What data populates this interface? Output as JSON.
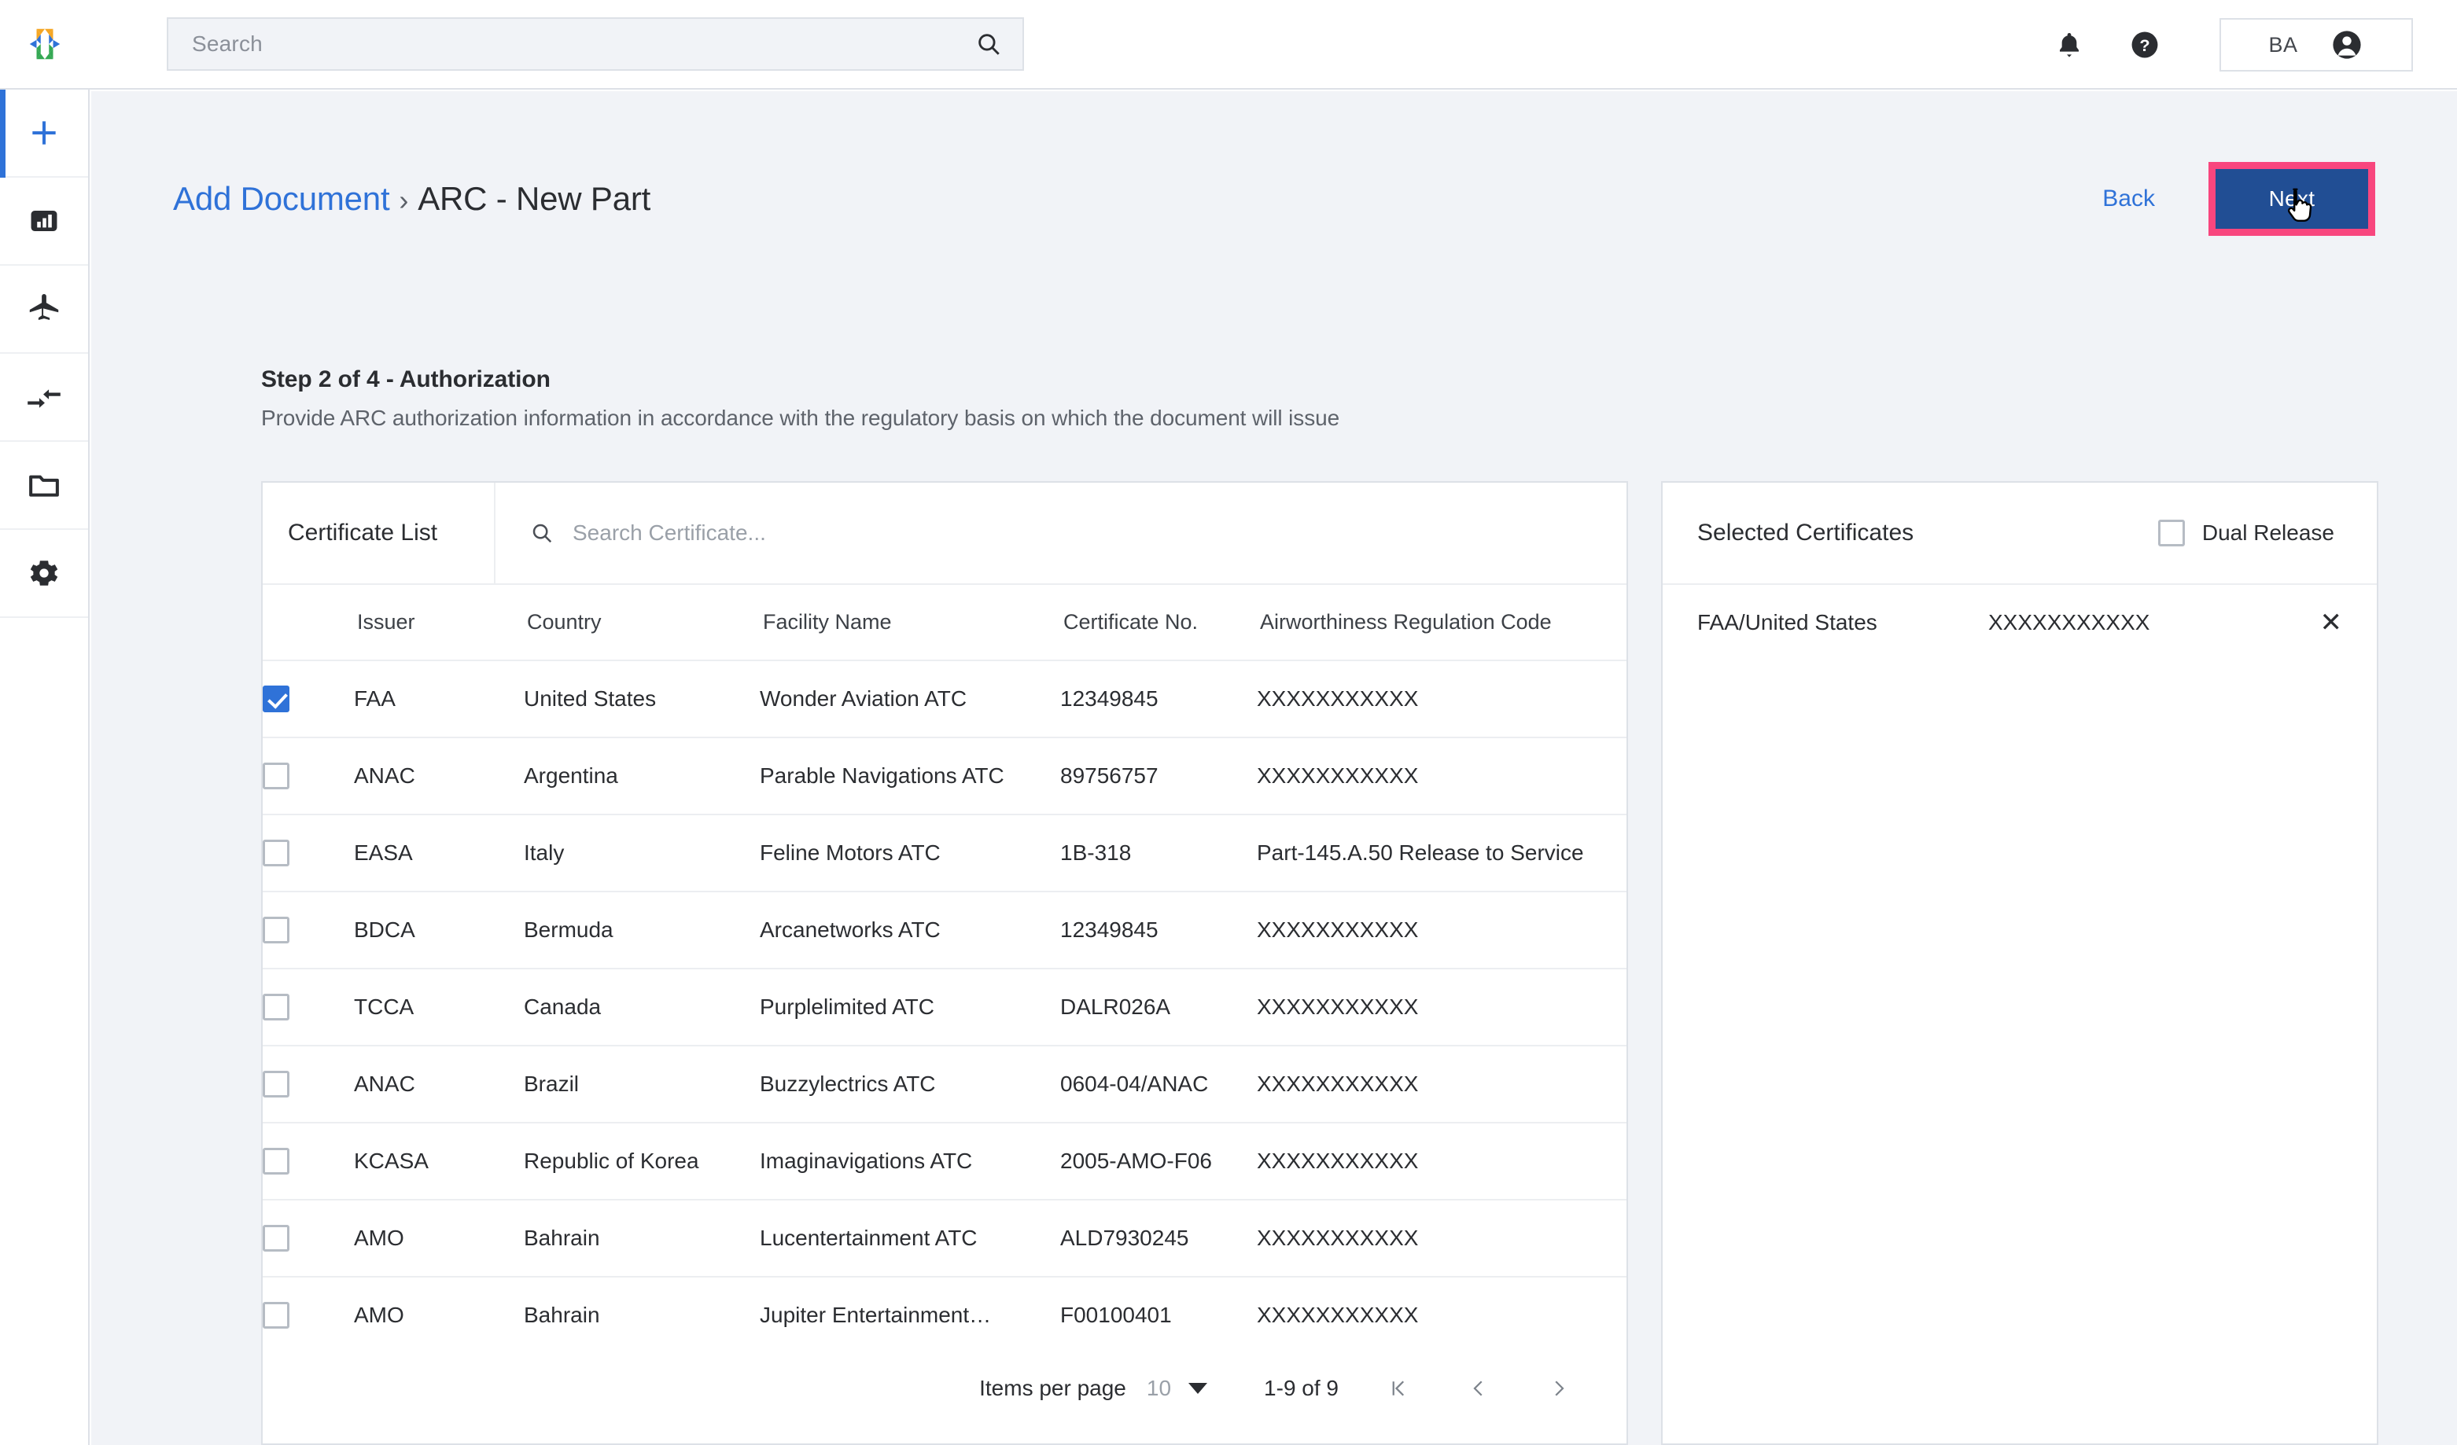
{
  "brand": {
    "logo_icon": "hexagon-logo-icon",
    "accent_blue": "#2f72d8",
    "button_blue": "#214e94",
    "highlight_pink": "#f8467e"
  },
  "topbar": {
    "search": {
      "placeholder": "Search",
      "value": "",
      "icon": "search-icon"
    },
    "notifications_icon": "bell-icon",
    "help_icon": "help-circle-icon",
    "user_initials": "BA",
    "user_avatar_icon": "account-circle-icon"
  },
  "sidebar": {
    "items": [
      {
        "name": "add",
        "icon": "plus-icon",
        "active": true
      },
      {
        "name": "dashboard",
        "icon": "bar-chart-icon",
        "active": false
      },
      {
        "name": "aircraft",
        "icon": "airplane-icon",
        "active": false
      },
      {
        "name": "transfer",
        "icon": "transfer-arrows-icon",
        "active": false
      },
      {
        "name": "documents",
        "icon": "folder-icon",
        "active": false
      },
      {
        "name": "settings",
        "icon": "gear-icon",
        "active": false
      }
    ]
  },
  "page": {
    "breadcrumb_link": "Add Document",
    "breadcrumb_separator": "›",
    "breadcrumb_current": "ARC - New Part",
    "back_label": "Back",
    "next_label": "Next",
    "step_title": "Step 2 of 4 - Authorization",
    "step_description": "Provide ARC authorization information in accordance with the regulatory basis on which the document will issue"
  },
  "certificate_list": {
    "title": "Certificate List",
    "search_placeholder": "Search Certificate...",
    "search_icon": "search-icon",
    "columns": [
      "Issuer",
      "Country",
      "Facility Name",
      "Certificate No.",
      "Airworthiness Regulation Code"
    ],
    "rows": [
      {
        "checked": true,
        "issuer": "FAA",
        "country": "United States",
        "facility": "Wonder Aviation ATC",
        "certificate_no": "12349845",
        "regulation_code": "XXXXXXXXXXX"
      },
      {
        "checked": false,
        "issuer": "ANAC",
        "country": "Argentina",
        "facility": "Parable Navigations ATC",
        "certificate_no": "89756757",
        "regulation_code": "XXXXXXXXXXX"
      },
      {
        "checked": false,
        "issuer": "EASA",
        "country": "Italy",
        "facility": "Feline Motors ATC",
        "certificate_no": "1B-318",
        "regulation_code": "Part-145.A.50 Release to Service"
      },
      {
        "checked": false,
        "issuer": "BDCA",
        "country": "Bermuda",
        "facility": "Arcanetworks ATC",
        "certificate_no": "12349845",
        "regulation_code": "XXXXXXXXXXX"
      },
      {
        "checked": false,
        "issuer": "TCCA",
        "country": "Canada",
        "facility": "Purplelimited ATC",
        "certificate_no": "DALR026A",
        "regulation_code": "XXXXXXXXXXX"
      },
      {
        "checked": false,
        "issuer": "ANAC",
        "country": "Brazil",
        "facility": "Buzzylectrics ATC",
        "certificate_no": "0604-04/ANAC",
        "regulation_code": "XXXXXXXXXXX"
      },
      {
        "checked": false,
        "issuer": "KCASA",
        "country": "Republic of Korea",
        "facility": "Imaginavigations ATC",
        "certificate_no": "2005-AMO-F06",
        "regulation_code": "XXXXXXXXXXX"
      },
      {
        "checked": false,
        "issuer": "AMO",
        "country": "Bahrain",
        "facility": "Lucentertainment ATC",
        "certificate_no": "ALD7930245",
        "regulation_code": "XXXXXXXXXXX"
      },
      {
        "checked": false,
        "issuer": "AMO",
        "country": "Bahrain",
        "facility": "Jupiter Entertainment…",
        "certificate_no": "F00100401",
        "regulation_code": "XXXXXXXXXXX"
      }
    ],
    "pagination": {
      "items_per_page_label": "Items per page",
      "items_per_page_value": "10",
      "range_label": "1-9 of 9",
      "first_page_icon": "first-page-icon",
      "prev_page_icon": "chevron-left-icon",
      "next_page_icon": "chevron-right-icon"
    }
  },
  "selected_certificates": {
    "title": "Selected Certificates",
    "dual_release_label": "Dual Release",
    "dual_release_checked": false,
    "rows": [
      {
        "name": "FAA/United States",
        "code": "XXXXXXXXXXX",
        "remove_icon": "close-icon"
      }
    ]
  }
}
